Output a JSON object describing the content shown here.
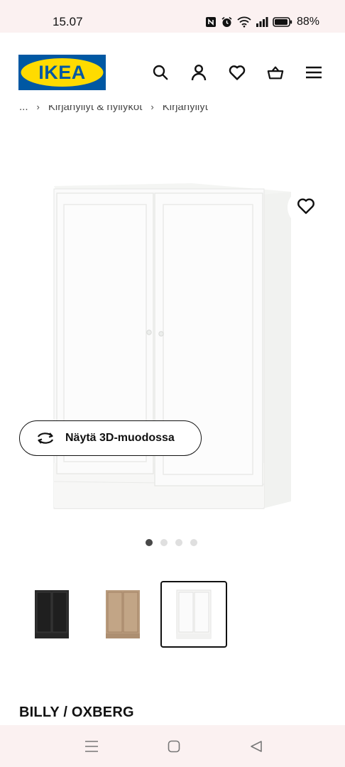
{
  "status_bar": {
    "time": "15.07",
    "battery": "88%",
    "icons": [
      "nfc-icon",
      "alarm-icon",
      "wifi-icon",
      "signal-icon",
      "battery-icon"
    ]
  },
  "header": {
    "logo_text": "IKEA",
    "icons": [
      "search-icon",
      "account-icon",
      "heart-icon",
      "basket-icon",
      "menu-icon"
    ]
  },
  "breadcrumb": {
    "ellipsis": "...",
    "items": [
      "Kirjahyllyt & hyllyköt",
      "Kirjahyllyt"
    ]
  },
  "product": {
    "view_3d_label": "Näytä 3D-muodossa",
    "image_count": 4,
    "active_image_index": 0,
    "thumbnails": [
      {
        "color_name": "black",
        "color": "#2b2b2b"
      },
      {
        "color_name": "oak",
        "color": "#b89a7c"
      },
      {
        "color_name": "white",
        "color": "#f4f4f2"
      }
    ],
    "selected_thumbnail_index": 2,
    "name": "BILLY / OXBERG"
  },
  "colors": {
    "ikea_blue": "#0058a3",
    "ikea_yellow": "#ffdb00",
    "status_bg": "#fbf1f1"
  }
}
